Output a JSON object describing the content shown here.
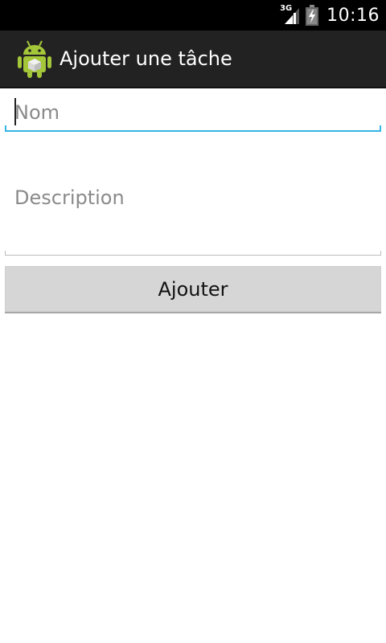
{
  "status_bar": {
    "network_type": "3G",
    "time": "10:16",
    "icons": [
      "signal-icon",
      "battery-charging-icon"
    ]
  },
  "action_bar": {
    "app_icon": "android-app-icon",
    "title": "Ajouter une tâche"
  },
  "form": {
    "name": {
      "placeholder": "Nom",
      "value": ""
    },
    "description": {
      "placeholder": "Description",
      "value": ""
    },
    "submit_label": "Ajouter"
  },
  "colors": {
    "status_bar_bg": "#000000",
    "action_bar_bg": "#222222",
    "focus_accent": "#33b5e5",
    "button_bg": "#d6d6d6",
    "android_green": "#a4c639"
  }
}
